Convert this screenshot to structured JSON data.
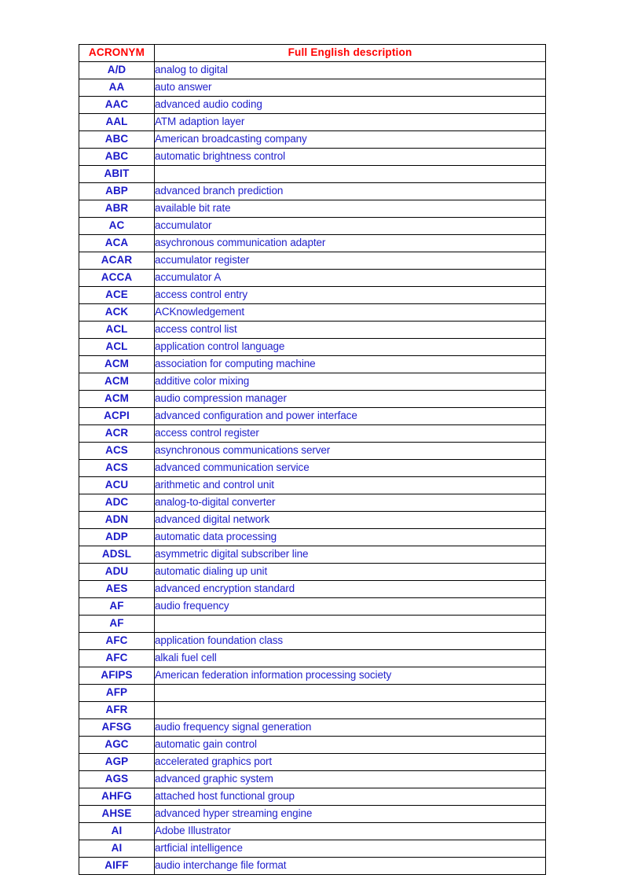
{
  "table": {
    "title_columns": {
      "acronym": "ACRONYM",
      "description": "Full English description"
    },
    "colors": {
      "header_text": "#ff0000",
      "acronym_text": "#1a19c8",
      "description_text": "#2222cc",
      "border": "#000000",
      "background": "#ffffff"
    },
    "rows": [
      {
        "acronym": "A/D",
        "description": "analog to digital"
      },
      {
        "acronym": "AA",
        "description": "auto answer"
      },
      {
        "acronym": "AAC",
        "description": "advanced audio coding"
      },
      {
        "acronym": "AAL",
        "description": "ATM adaption layer"
      },
      {
        "acronym": "ABC",
        "description": "American broadcasting company"
      },
      {
        "acronym": "ABC",
        "description": "automatic brightness control"
      },
      {
        "acronym": "ABIT",
        "description": ""
      },
      {
        "acronym": "ABP",
        "description": "advanced branch prediction"
      },
      {
        "acronym": "ABR",
        "description": "available bit rate"
      },
      {
        "acronym": "AC",
        "description": "accumulator"
      },
      {
        "acronym": "ACA",
        "description": "asychronous communication adapter"
      },
      {
        "acronym": "ACAR",
        "description": "accumulator register"
      },
      {
        "acronym": "ACCA",
        "description": "accumulator A"
      },
      {
        "acronym": "ACE",
        "description": "access control entry"
      },
      {
        "acronym": "ACK",
        "description": "ACKnowledgement"
      },
      {
        "acronym": "ACL",
        "description": "access control list"
      },
      {
        "acronym": "ACL",
        "description": "application control language"
      },
      {
        "acronym": "ACM",
        "description": "association for computing machine"
      },
      {
        "acronym": "ACM",
        "description": "additive color mixing"
      },
      {
        "acronym": "ACM",
        "description": "audio compression manager"
      },
      {
        "acronym": "ACPI",
        "description": "advanced configuration and power interface"
      },
      {
        "acronym": "ACR",
        "description": "access control register"
      },
      {
        "acronym": "ACS",
        "description": "asynchronous communications server"
      },
      {
        "acronym": "ACS",
        "description": "advanced communication service"
      },
      {
        "acronym": "ACU",
        "description": "arithmetic and control unit"
      },
      {
        "acronym": "ADC",
        "description": "analog-to-digital converter"
      },
      {
        "acronym": "ADN",
        "description": "advanced digital network"
      },
      {
        "acronym": "ADP",
        "description": "automatic data processing"
      },
      {
        "acronym": "ADSL",
        "description": "asymmetric digital subscriber line"
      },
      {
        "acronym": "ADU",
        "description": "automatic dialing up unit"
      },
      {
        "acronym": "AES",
        "description": "advanced encryption standard"
      },
      {
        "acronym": "AF",
        "description": "audio frequency"
      },
      {
        "acronym": "AF",
        "description": ""
      },
      {
        "acronym": "AFC",
        "description": "application foundation class"
      },
      {
        "acronym": "AFC",
        "description": "alkali fuel cell"
      },
      {
        "acronym": "AFIPS",
        "description": "American federation information processing society"
      },
      {
        "acronym": "AFP",
        "description": ""
      },
      {
        "acronym": "AFR",
        "description": ""
      },
      {
        "acronym": "AFSG",
        "description": "audio frequency signal generation"
      },
      {
        "acronym": "AGC",
        "description": "automatic gain control"
      },
      {
        "acronym": "AGP",
        "description": "accelerated graphics port"
      },
      {
        "acronym": "AGS",
        "description": "advanced graphic system"
      },
      {
        "acronym": "AHFG",
        "description": "attached host functional group"
      },
      {
        "acronym": "AHSE",
        "description": "advanced hyper streaming engine"
      },
      {
        "acronym": "AI",
        "description": "Adobe Illustrator"
      },
      {
        "acronym": "AI",
        "description": "artficial intelligence"
      },
      {
        "acronym": "AIFF",
        "description": "audio interchange file format"
      }
    ]
  }
}
